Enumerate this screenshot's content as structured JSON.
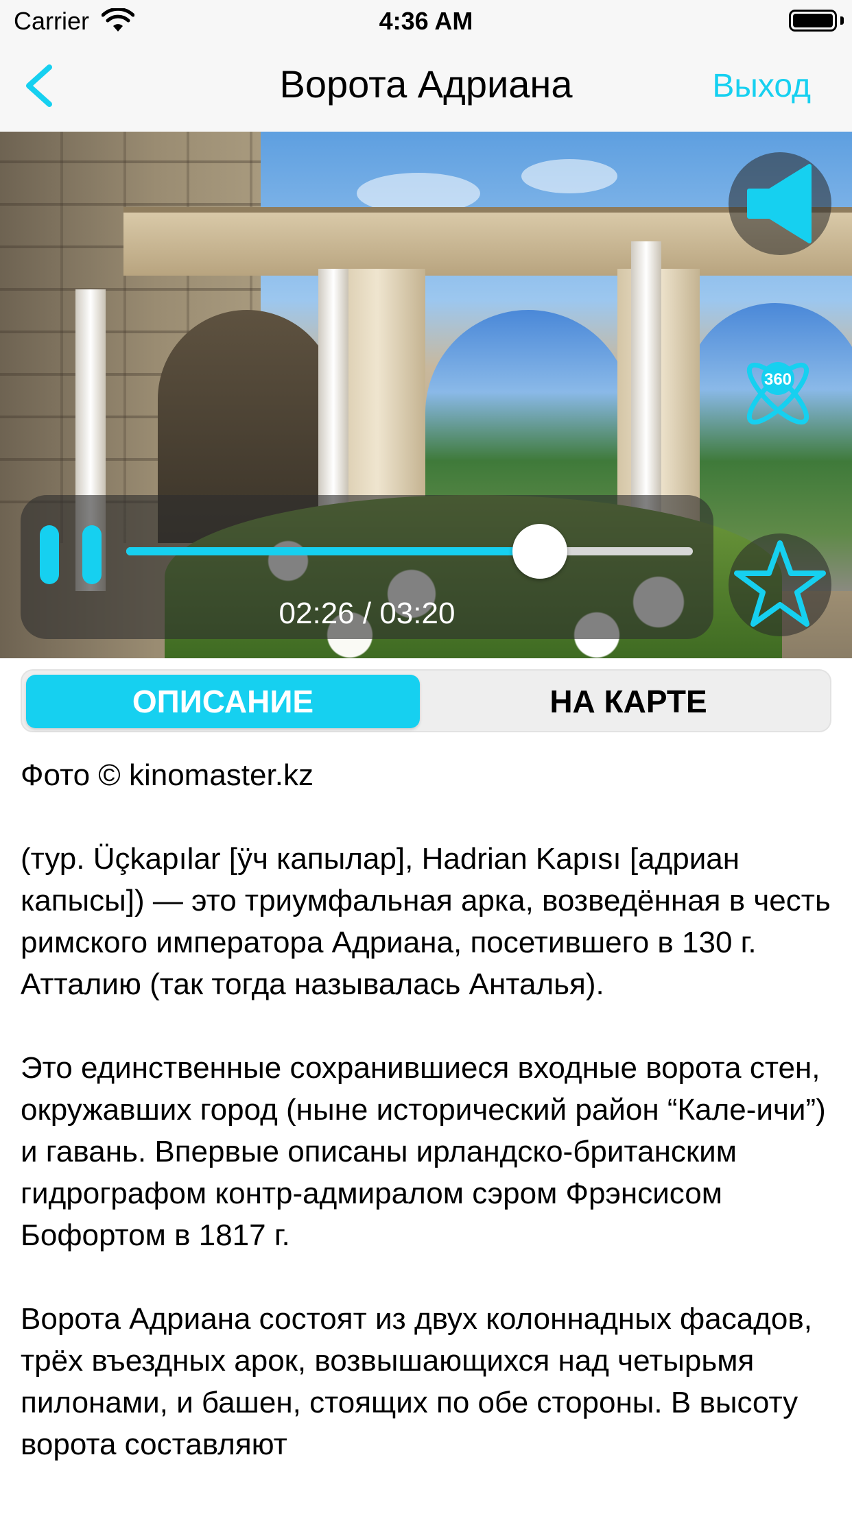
{
  "status_bar": {
    "carrier": "Carrier",
    "time": "4:36 AM",
    "icons": [
      "wifi-icon",
      "battery-icon"
    ]
  },
  "nav": {
    "back_icon": "chevron-left-icon",
    "title": "Ворота Адриана",
    "exit_label": "Выход",
    "accent_color": "#16d0f0"
  },
  "player": {
    "current_time": "02:26",
    "total_time": "03:20",
    "time_display": "02:26 / 03:20",
    "progress": 0.73,
    "state": "playing",
    "icons": [
      "pause-icon",
      "speaker-icon",
      "vr-360-icon",
      "star-icon"
    ]
  },
  "tabs": [
    {
      "label": "ОПИСАНИЕ",
      "active": true
    },
    {
      "label": "НА КАРТЕ",
      "active": false
    }
  ],
  "description": {
    "photo_credit": "Фото © kinomaster.kz",
    "paragraphs": [
      "(тур. Üçkapılar [ӱч капылар], Hadrian Kapısı [адриан капысы]) — это триумфальная арка, возведённая в честь римского императора Адриана, посетившего в 130 г. Атталию (так тогда называлась Анталья).",
      "Это единственные сохранившиеся входные ворота стен, окружавших город (ныне исторический район “Кале-ичи”) и гавань. Впервые описаны ирландско-британским гидрографом контр-адмиралом сэром Фрэнсисом Бофортом в 1817 г.",
      "Ворота Адриана состоят из двух колоннадных фасадов, трёх въездных арок, возвышающихся над четырьмя пилонами, и башен, стоящих по обе стороны. В высоту ворота составляют"
    ]
  }
}
